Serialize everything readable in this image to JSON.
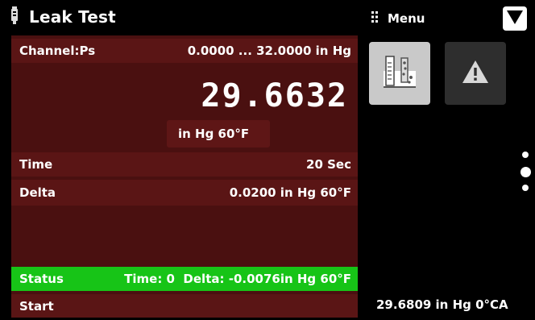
{
  "header": {
    "title": "Leak Test",
    "title_icon": "thermometer-icon",
    "menu_label": "Menu",
    "menu_icon": "grip-dots-icon",
    "dropdown_icon": "triangle-down-icon"
  },
  "channel": {
    "label": "Channel:Ps",
    "range": "0.0000 ... 32.0000 in Hg"
  },
  "reading": {
    "value": "29.6632",
    "unit": "in Hg 60°F"
  },
  "time": {
    "label": "Time",
    "value": "20 Sec"
  },
  "delta": {
    "label": "Delta",
    "value": "0.0200 in Hg 60°F"
  },
  "status": {
    "label": "Status",
    "value": "Time: 0  Delta: -0.0076in Hg 60°F"
  },
  "start": {
    "label": "Start"
  },
  "tiles": [
    {
      "icon": "beaker-sensor-icon"
    },
    {
      "icon": "warning-triangle-icon"
    }
  ],
  "barometer": {
    "value": "29.6809 in Hg 0°CA"
  },
  "colors": {
    "background": "#000000",
    "panel": "#4a1010",
    "row": "#5a1515",
    "status_ok": "#17c417",
    "tile_active": "#c9c9c9",
    "tile_idle": "#2e2e2e"
  }
}
